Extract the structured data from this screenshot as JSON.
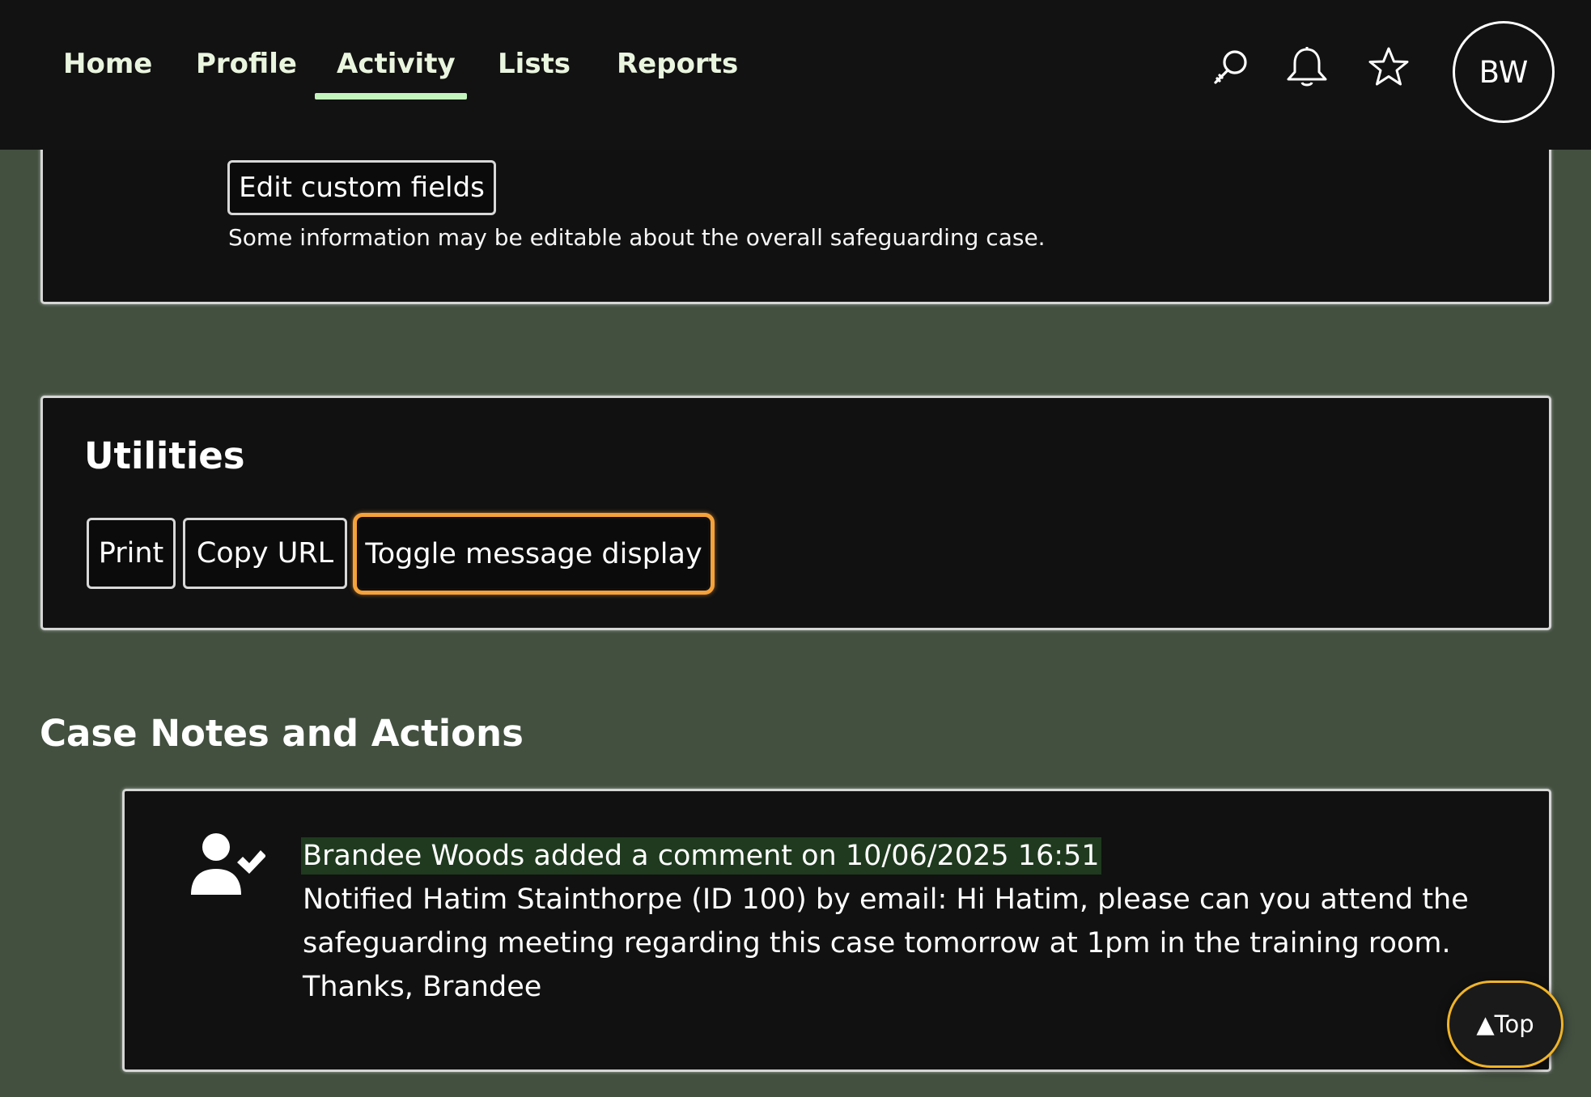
{
  "nav": {
    "tabs": [
      {
        "label": "Home"
      },
      {
        "label": "Profile"
      },
      {
        "label": "Activity",
        "active": true
      },
      {
        "label": "Lists"
      },
      {
        "label": "Reports"
      }
    ],
    "icons": [
      "search-icon",
      "bell-icon",
      "star-icon"
    ],
    "avatar_initials": "BW"
  },
  "case_panel": {
    "edit_button_label": "Edit custom fields",
    "hint": "Some information may be editable about the overall safeguarding case."
  },
  "utilities": {
    "title": "Utilities",
    "buttons": {
      "print": "Print",
      "copy_url": "Copy URL",
      "toggle": "Toggle message display"
    }
  },
  "notes": {
    "heading": "Case Notes and Actions",
    "items": [
      {
        "icon": "user-check-icon",
        "meta": "Brandee Woods added a comment on 10/06/2025 16:51",
        "body": "Notified Hatim Stainthorpe (ID 100) by email: Hi Hatim, please can you attend the safeguarding meeting regarding this case tomorrow at 1pm in the training room. Thanks, Brandee"
      }
    ]
  },
  "back_to_top": "▲Top",
  "colors": {
    "background": "#435040",
    "topbar": "#121212",
    "nav_active_underline": "#c3f4bd",
    "focus_ring": "#f6a23a",
    "meta_highlight": "#1f3a1e",
    "top_button_border": "#f0b429"
  }
}
